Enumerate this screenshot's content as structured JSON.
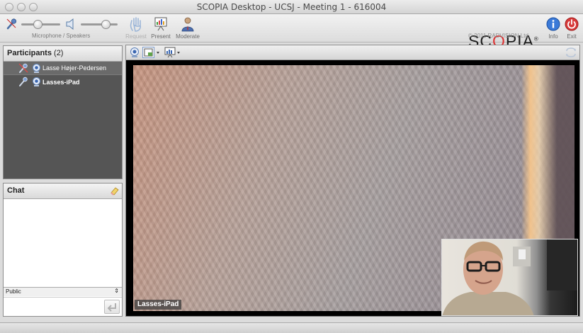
{
  "window": {
    "title": "SCOPIA Desktop - UCSJ - Meeting 1 - 616004"
  },
  "toolbar": {
    "audio_label": "Microphone / Speakers",
    "microphone_level": 0.4,
    "speaker_level": 0.75,
    "request_label": "Request",
    "present_label": "Present",
    "moderate_label": "Moderate",
    "info_label": "Info",
    "exit_label": "Exit"
  },
  "brand": {
    "logo_text_before": "SC",
    "logo_text_o": "O",
    "logo_text_after": "PIA",
    "logo_mark": "®",
    "copyright": "© 2011 RADVISION Ltd.",
    "accent_color": "#d33333"
  },
  "participants": {
    "title": "Participants",
    "count": "(2)",
    "items": [
      {
        "name": "Lasse Højer-Pedersen"
      },
      {
        "name": "Lasses-iPad"
      }
    ]
  },
  "chat": {
    "title": "Chat",
    "recipient": "Public",
    "message": ""
  },
  "video": {
    "main_caption": "Lasses-iPad"
  }
}
